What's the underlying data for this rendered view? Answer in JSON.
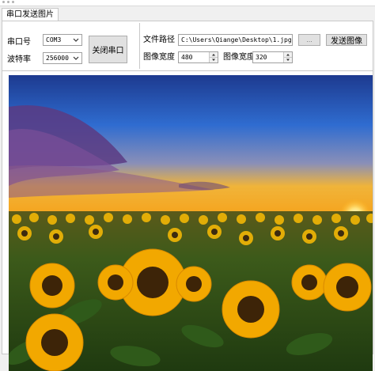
{
  "tab": {
    "label": "串口发送图片"
  },
  "serial": {
    "port_label": "串口号",
    "port_value": "COM3",
    "baud_label": "波特率",
    "baud_value": "256000",
    "close_button": "关闭串口"
  },
  "file": {
    "path_label": "文件路径",
    "path_value": "C:\\Users\\Qiange\\Desktop\\1.jpg",
    "browse_button": "...",
    "send_button": "发送图像"
  },
  "image": {
    "width_label": "图像宽度",
    "width_value": "480",
    "height_label": "图像宽度",
    "height_value": "320"
  },
  "colors": {
    "sky_top": "#1d3a8f",
    "sky_horizon": "#f6a21a",
    "sunflower": "#f2b705",
    "leaf": "#2f5a1a"
  }
}
